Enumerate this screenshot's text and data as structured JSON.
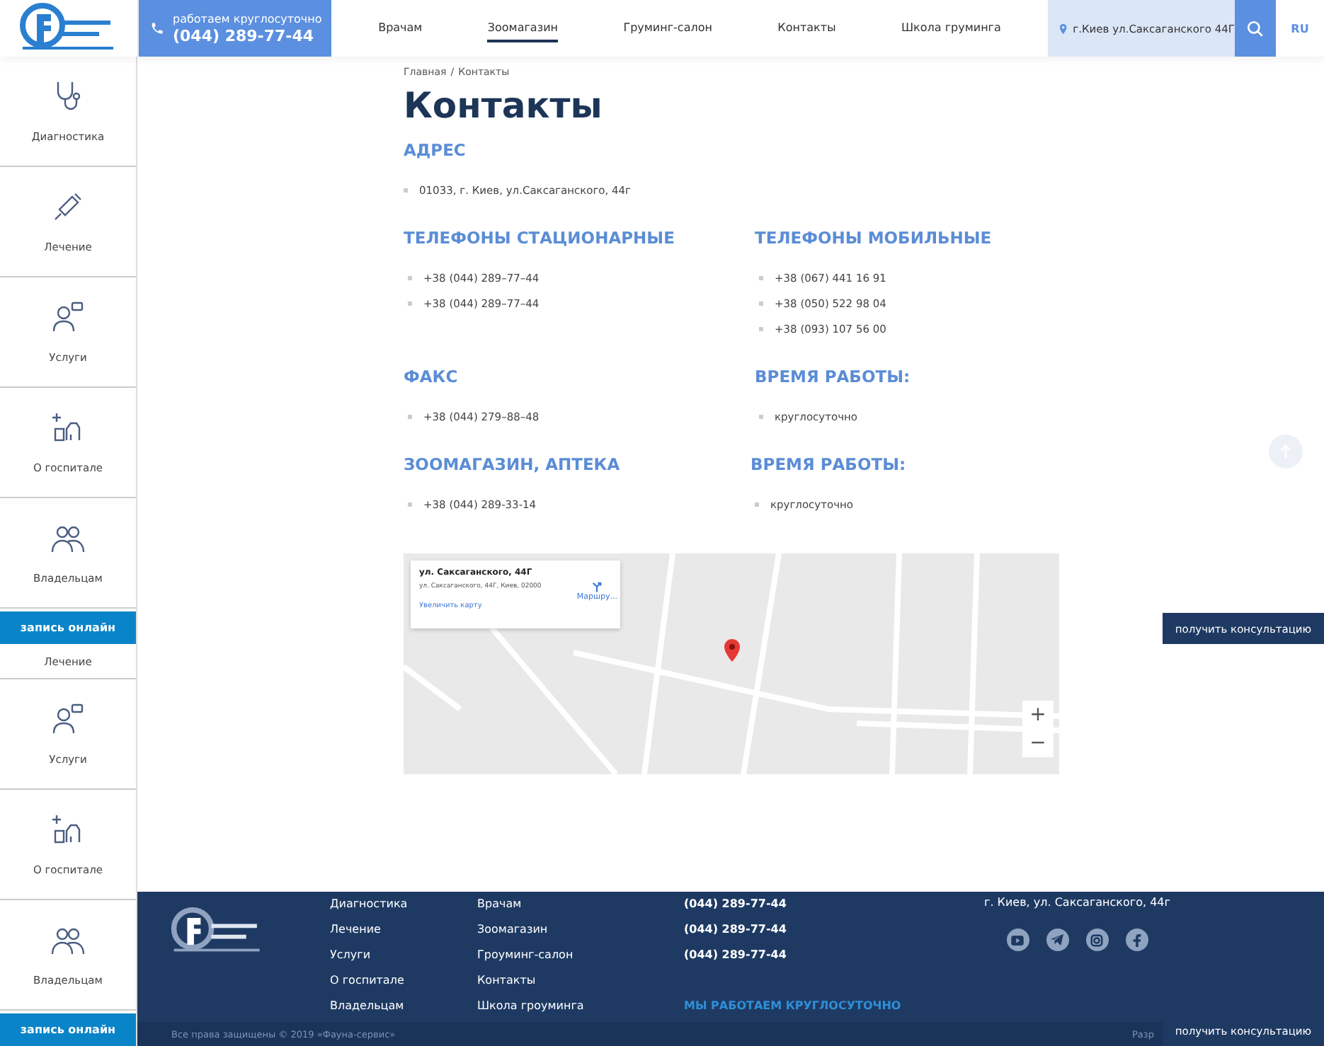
{
  "header": {
    "phone_caption": "работаем круглосуточно",
    "phone": "(044) 289-77-44",
    "nav": [
      {
        "label": "Врачам",
        "selected": false
      },
      {
        "label": "Зоомагазин",
        "selected": true
      },
      {
        "label": "Груминг-салон",
        "selected": false
      },
      {
        "label": "Контакты",
        "selected": false
      },
      {
        "label": "Школа груминга",
        "selected": false
      }
    ],
    "location": "г.Киев ул.Саксаганского 44Г",
    "language": "RU"
  },
  "sidebar": {
    "items": [
      {
        "kind": "nav",
        "label": "Диагностика"
      },
      {
        "kind": "nav",
        "label": "Лечение"
      },
      {
        "kind": "nav",
        "label": "Услуги"
      },
      {
        "kind": "nav",
        "label": "О госпитале"
      },
      {
        "kind": "nav",
        "label": "Владельцам"
      },
      {
        "kind": "button",
        "label": "запись онлайн"
      },
      {
        "kind": "label",
        "label": "Лечение"
      },
      {
        "kind": "nav",
        "label": "Услуги"
      },
      {
        "kind": "nav",
        "label": "О госпитале"
      },
      {
        "kind": "nav",
        "label": "Владельцам"
      },
      {
        "kind": "button",
        "label": "запись онлайн"
      }
    ]
  },
  "breadcrumbs": [
    "Главная",
    "Контакты"
  ],
  "breadcrumb_separator": "/",
  "title": "Контакты",
  "address": {
    "heading": "АДРЕС",
    "items": [
      "01033, г. Киев, ул.Саксаганского, 44г"
    ]
  },
  "sections": [
    {
      "heading": "ТЕЛЕФОНЫ СТАЦИОНАРНЫЕ",
      "items": [
        "+38 (044) 289–77–44",
        "+38 (044) 289–77–44"
      ]
    },
    {
      "heading": "ТЕЛЕФОНЫ МОБИЛЬНЫЕ",
      "items": [
        "+38 (067) 441 16 91",
        "+38 (050) 522 98 04",
        "+38 (093) 107 56 00"
      ]
    },
    {
      "heading": "ФАКС",
      "items": [
        "+38 (044) 279–88–48"
      ]
    },
    {
      "heading": "ВРЕМЯ РАБОТЫ:",
      "items": [
        "круглосуточно"
      ]
    },
    {
      "heading": "ЗООМАГАЗИН, АПТЕКА",
      "items": [
        "+38 (044) 289-33-14"
      ]
    },
    {
      "heading": "ВРЕМЯ РАБОТЫ:",
      "items": [
        "круглосуточно"
      ]
    }
  ],
  "map": {
    "place_title": "ул. Саксаганского, 44Г",
    "place_address": "ул. Саксаганского, 44Г, Киев, 02000",
    "route": "Маршру...",
    "enlarge": "Увеличить карту",
    "zoom_in": "+",
    "zoom_out": "−"
  },
  "footer": {
    "menu_1": [
      "Диагностика",
      "Лечение",
      "Услуги",
      "О госпитале",
      "Владельцам"
    ],
    "menu_2": [
      "Врачам",
      "Зоомагазин",
      "Гроуминг-салон",
      "Контакты",
      "Школа гроуминга"
    ],
    "phones": [
      "(044) 289-77-44",
      "(044) 289-77-44",
      "(044) 289-77-44"
    ],
    "hours": "МЫ РАБОТАЕМ КРУГЛОСУТОЧНО",
    "address": "г. Киев, ул. Саксаганского, 44г",
    "copyright": "Все права защищены © 2019 «Фауна-сервис»",
    "developer": "Разр"
  },
  "consult_buttons": [
    "получить консультацию",
    "получить консультацию"
  ]
}
